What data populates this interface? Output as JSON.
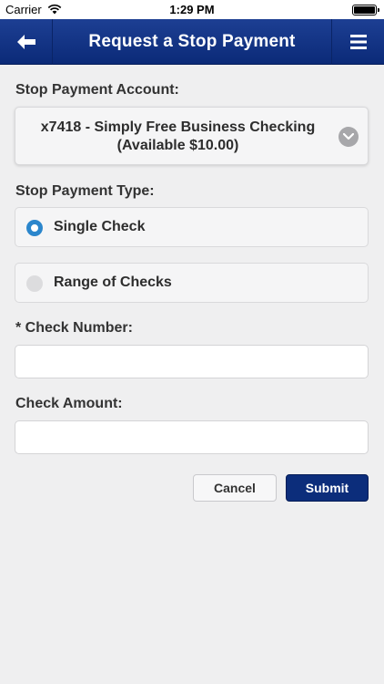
{
  "status_bar": {
    "carrier": "Carrier",
    "time": "1:29 PM"
  },
  "nav": {
    "title": "Request a Stop Payment",
    "back_icon": "back-arrow-icon",
    "menu_icon": "hamburger-menu-icon"
  },
  "form": {
    "account_label": "Stop Payment Account:",
    "account_line1": "x7418 - Simply Free Business Checking",
    "account_line2": "(Available $10.00)",
    "type_label": "Stop Payment Type:",
    "options": [
      {
        "label": "Single Check",
        "selected": true
      },
      {
        "label": "Range of Checks",
        "selected": false
      }
    ],
    "check_number_label": "* Check Number:",
    "check_number_value": "",
    "check_amount_label": "Check Amount:",
    "check_amount_value": ""
  },
  "buttons": {
    "cancel": "Cancel",
    "submit": "Submit"
  },
  "colors": {
    "nav": "#0b2a78",
    "radio_on": "#2b86cc",
    "submit": "#0c2d7b"
  }
}
